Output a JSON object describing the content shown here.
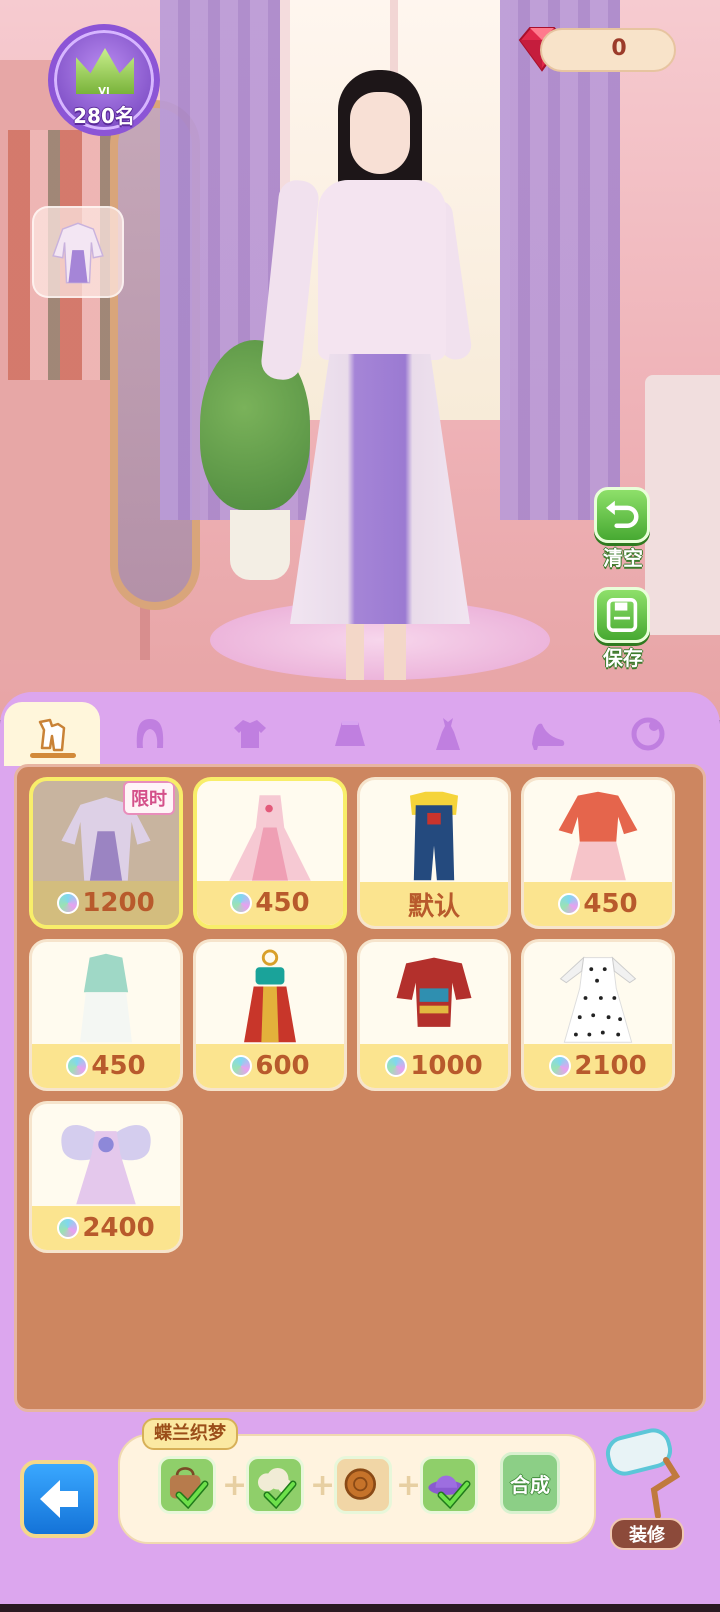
{
  "hud": {
    "rank_level": "VI",
    "rank_text": "280名",
    "gem_count": "0"
  },
  "side_buttons": {
    "clear_label": "清空",
    "save_label": "保存"
  },
  "tabs": [
    {
      "name": "outfit",
      "icon": "outfit-set-icon",
      "active": true
    },
    {
      "name": "hair",
      "icon": "hair-icon",
      "active": false
    },
    {
      "name": "top",
      "icon": "shirt-icon",
      "active": false
    },
    {
      "name": "skirt",
      "icon": "skirt-icon",
      "active": false
    },
    {
      "name": "dress",
      "icon": "dress-icon",
      "active": false
    },
    {
      "name": "shoes",
      "icon": "high-heel-icon",
      "active": false
    },
    {
      "name": "accessory",
      "icon": "accessory-icon",
      "active": false
    }
  ],
  "items": [
    {
      "price": "1200",
      "tag": "限时",
      "equipped": true,
      "selected": true,
      "art": "lavender-hanfu"
    },
    {
      "price": "450",
      "selected": true,
      "art": "pink-gown"
    },
    {
      "price": "默认",
      "default": true,
      "art": "overalls"
    },
    {
      "price": "450",
      "art": "red-pink-dress"
    },
    {
      "price": "450",
      "art": "mint-qipao"
    },
    {
      "price": "600",
      "art": "red-ethnic-dress"
    },
    {
      "price": "1000",
      "art": "colorful-folk-dress"
    },
    {
      "price": "2100",
      "art": "polka-dot-dress"
    },
    {
      "price": "2400",
      "art": "fairy-wing-dress"
    }
  ],
  "combo": {
    "title": "蝶兰织梦",
    "synth_label": "合成",
    "slots": [
      {
        "icon": "bag-icon",
        "checked": true
      },
      {
        "icon": "cloud-scroll-icon",
        "checked": true
      },
      {
        "icon": "mooncake-icon",
        "checked": false
      },
      {
        "icon": "hat-icon",
        "checked": true
      }
    ]
  },
  "decor_label": "装修",
  "colors": {
    "panel": "#dca6ee",
    "grid_bg": "#cd8660",
    "price_bar": "#fbe48f",
    "price_text": "#b85a2c",
    "green_button": "#47a932"
  }
}
